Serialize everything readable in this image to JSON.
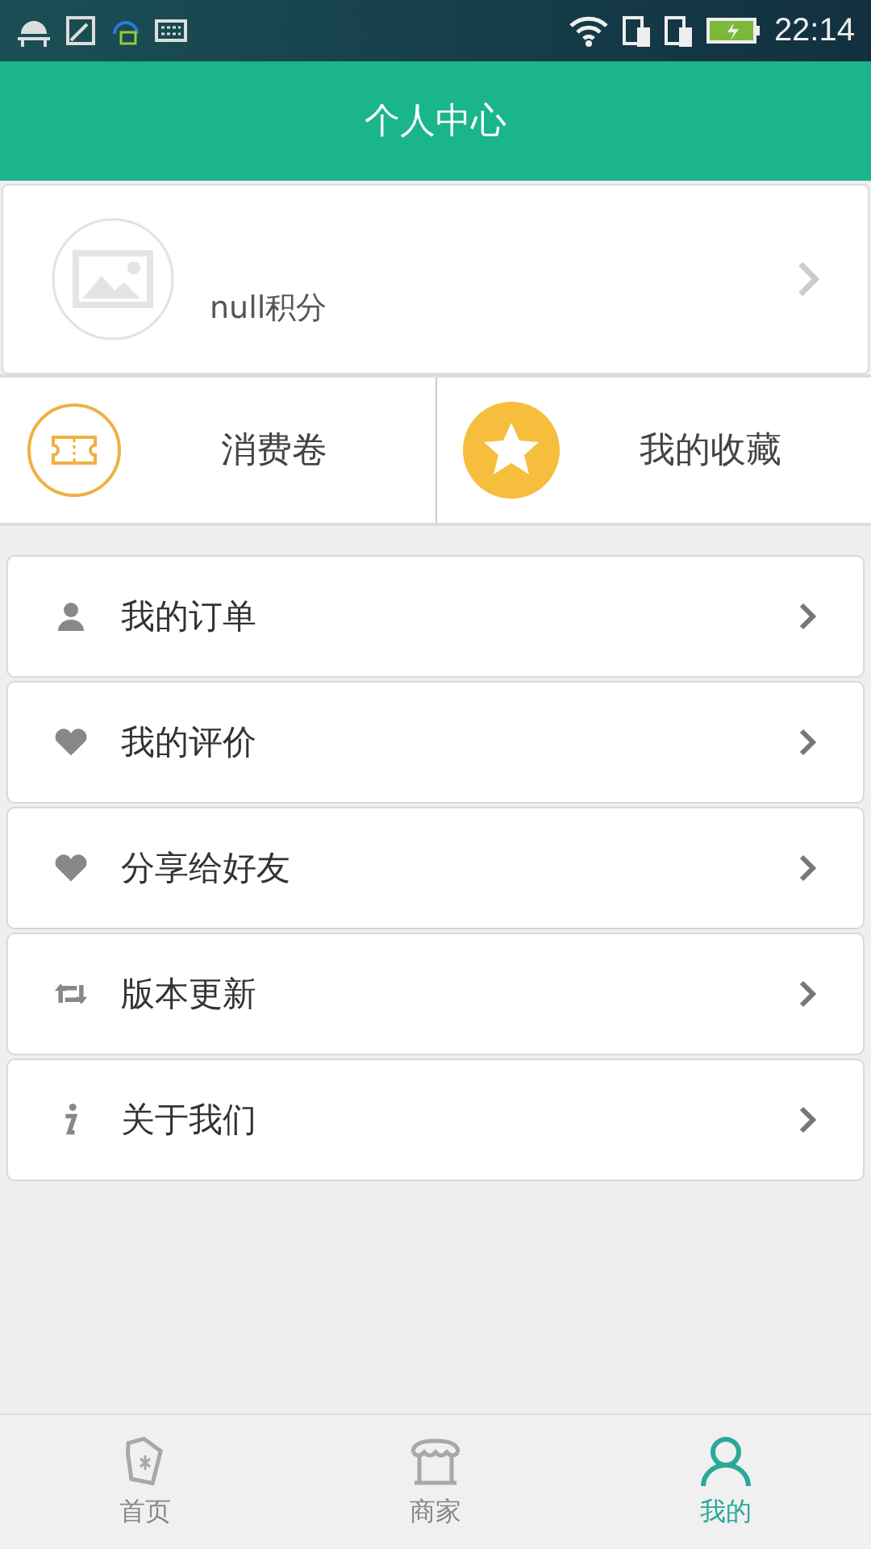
{
  "status_bar": {
    "time": "22:14"
  },
  "header": {
    "title": "个人中心"
  },
  "profile": {
    "points": "null积分"
  },
  "shortcuts": [
    {
      "kind": "ticket",
      "label": "消费卷"
    },
    {
      "kind": "star",
      "label": "我的收藏"
    }
  ],
  "menu": [
    {
      "kind": "person",
      "label": "我的订单"
    },
    {
      "kind": "heart",
      "label": "我的评价"
    },
    {
      "kind": "heart",
      "label": "分享给好友"
    },
    {
      "kind": "repeat",
      "label": "版本更新"
    },
    {
      "kind": "info",
      "label": "关于我们"
    }
  ],
  "tab_bar": [
    {
      "kind": "tag",
      "label": "首页",
      "selected": false
    },
    {
      "kind": "shop",
      "label": "商家",
      "selected": false
    },
    {
      "kind": "person",
      "label": "我的",
      "selected": true
    }
  ]
}
